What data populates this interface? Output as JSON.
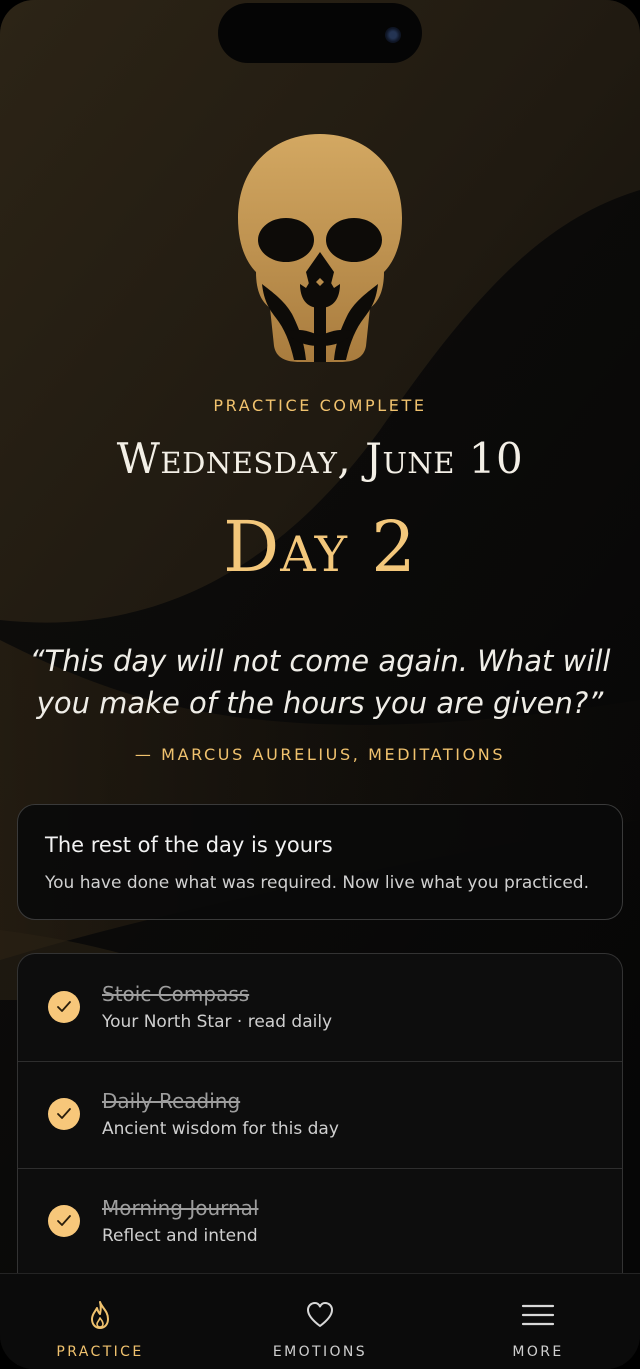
{
  "header": {
    "eyebrow": "PRACTICE COMPLETE",
    "date": "Wednesday, June 10",
    "day": "Day 2"
  },
  "quote": {
    "text": "“This day will not come again. What will you make of the hours you are given?”",
    "attribution": "— MARCUS AURELIUS, MEDITATIONS"
  },
  "summary_card": {
    "title": "The rest of the day is yours",
    "subtitle": "You have done what was required. Now live what you practiced."
  },
  "practices": [
    {
      "title": "Stoic Compass",
      "subtitle": "Your North Star · read daily",
      "completed": true
    },
    {
      "title": "Daily Reading",
      "subtitle": "Ancient wisdom for this day",
      "completed": true
    },
    {
      "title": "Morning Journal",
      "subtitle": "Reflect and intend",
      "completed": true
    }
  ],
  "tabs": [
    {
      "label": "PRACTICE",
      "icon": "flame-icon",
      "active": true
    },
    {
      "label": "EMOTIONS",
      "icon": "heart-icon",
      "active": false
    },
    {
      "label": "MORE",
      "icon": "menu-icon",
      "active": false
    }
  ],
  "colors": {
    "accent": "#f0c26e",
    "background": "#0b0a09",
    "card": "#0d0d0d"
  }
}
